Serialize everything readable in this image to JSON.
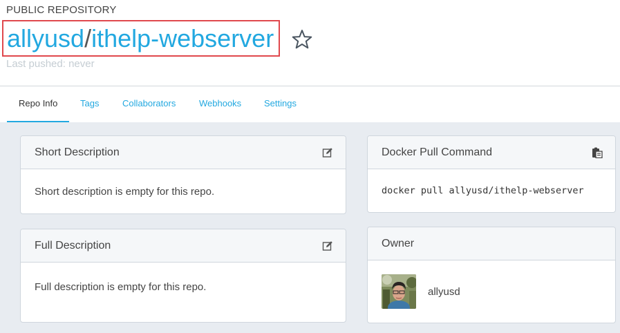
{
  "header": {
    "repo_type": "PUBLIC REPOSITORY",
    "namespace": "allyusd",
    "separator": "/",
    "repo_name": "ithelp-webserver",
    "last_pushed": "Last pushed: never",
    "star_icon": "star-outline-icon"
  },
  "tabs": [
    {
      "label": "Repo Info",
      "active": true
    },
    {
      "label": "Tags",
      "active": false
    },
    {
      "label": "Collaborators",
      "active": false
    },
    {
      "label": "Webhooks",
      "active": false
    },
    {
      "label": "Settings",
      "active": false
    }
  ],
  "panels": {
    "short_description": {
      "title": "Short Description",
      "body": "Short description is empty for this repo.",
      "icon": "edit-icon"
    },
    "full_description": {
      "title": "Full Description",
      "body": "Full description is empty for this repo.",
      "icon": "edit-icon"
    },
    "docker_pull": {
      "title": "Docker Pull Command",
      "command": "docker pull allyusd/ithelp-webserver",
      "icon": "clipboard-icon"
    },
    "owner": {
      "title": "Owner",
      "name": "allyusd",
      "avatar_icon": "avatar"
    }
  },
  "colors": {
    "accent": "#22a8e0",
    "highlight_box": "#e0474c",
    "content_bg": "#e8ecf1"
  }
}
